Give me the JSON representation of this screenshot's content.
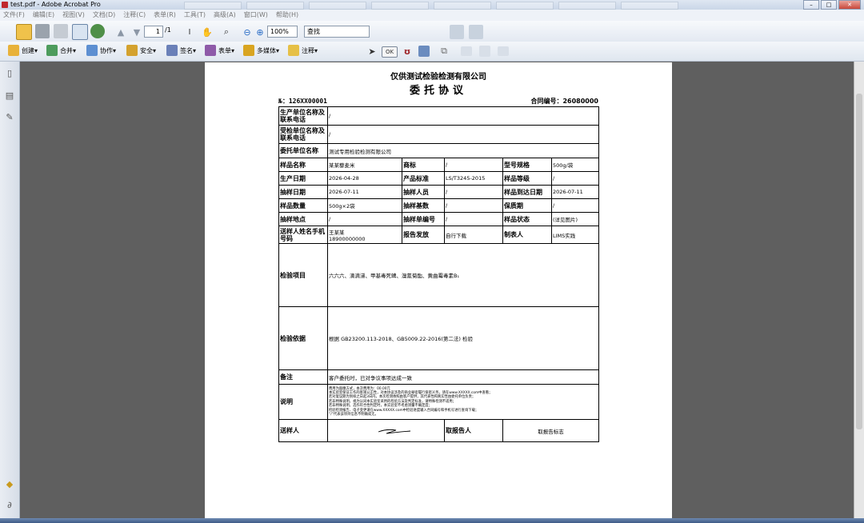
{
  "window": {
    "title": "test.pdf - Adobe Acrobat Pro",
    "controls": [
      "–",
      "□",
      "✕"
    ]
  },
  "menu": [
    "文件(F)",
    "编辑(E)",
    "视图(V)",
    "文档(D)",
    "注释(C)",
    "表单(R)",
    "工具(T)",
    "高级(A)",
    "窗口(W)",
    "帮助(H)"
  ],
  "toolbar": {
    "page_current": "1",
    "page_total": "/1",
    "zoom": "100%",
    "search_placeholder": "查找"
  },
  "toolbar2": {
    "create": "创建",
    "combine": "合并",
    "collaborate": "协作",
    "secure": "安全",
    "sign": "签名",
    "forms": "表单",
    "multimedia": "多媒体",
    "comment": "注释"
  },
  "doc": {
    "company": "仅供测试检验检测有限公司",
    "title": "委托协议",
    "no_label": "№：",
    "no_value": "126XX00001",
    "contract_label": "合同编号：",
    "contract_value": "26080000",
    "rows": {
      "producer_label": "生产单位名称及联系电话",
      "producer_value": "/",
      "inspected_label": "受检单位名称及联系电话",
      "inspected_value": "/",
      "client_label": "委托单位名称",
      "client_value": "测试专用检验检测有限公司",
      "sample_name_label": "样品名称",
      "sample_name_value": "某某藜麦米",
      "brand_label": "商标",
      "brand_value": "/",
      "spec_label": "型号规格",
      "spec_value": "500g/袋",
      "prod_date_label": "生产日期",
      "prod_date_value": "2026-04-28",
      "standard_label": "产品标准",
      "standard_value": "LS/T3245-2015",
      "grade_label": "样品等级",
      "grade_value": "/",
      "sample_date_label": "抽样日期",
      "sample_date_value": "2026-07-11",
      "sampler_label": "抽样人员",
      "sampler_value": "/",
      "arrival_label": "样品到达日期",
      "arrival_value": "2026-07-11",
      "qty_label": "样品数量",
      "qty_value": "500g×2袋",
      "base_label": "抽样基数",
      "base_value": "/",
      "shelf_label": "保质期",
      "shelf_value": "/",
      "place_label": "抽样地点",
      "place_value": "/",
      "sheet_no_label": "抽样单编号",
      "sheet_no_value": "/",
      "state_label": "样品状态",
      "state_value": "(详见图片)",
      "sender_label": "送样人姓名手机号码",
      "sender_name": "王某某",
      "sender_phone": "18900000000",
      "report_label": "报告发放",
      "report_value": "自行下载",
      "maker_label": "制表人",
      "maker_value": "LIMS实践",
      "items_label": "检验项目",
      "items_value": "六六六、滴滴涕、甲基毒死蜱、溴氰菊酯、黄曲霉毒素B₁",
      "basis_label": "检验依据",
      "basis_value": "根据 GB23200.113-2018、GB5009.22-2016(第二法) 检验",
      "remark_label": "备注",
      "remark_value": "客户委托时，已对争议事项达成一致",
      "notes_label": "说明",
      "notes": [
        "费用为面缴方式，本次费用为：00.00元",
        "本实验室保证工作的客观公正性，对本协议涉及的商业秘密履行保密义务，请在www.XXXXX.com中查看；",
        "若对复议期为到样之日起3日内，本次检测依照由客户提供，其代表性和真实性由委托单位负责；",
        "若非特殊说明，视为认同本实验室采用的检验方法及判定标准，请特殊检测不适用；",
        "若非特殊说明，选作符合性判定时，本实验室不考虑测量不确定度；",
        "检验检测报告、电子变更请在www.XXXXX.com中检验进度输入合同编号和手机号进行查询下载；",
        "“/”代表该项目信息不明确或无。"
      ],
      "sender2_label": "送样人",
      "pickup_label": "取报告人",
      "pickup_value": "取报告标志"
    }
  }
}
